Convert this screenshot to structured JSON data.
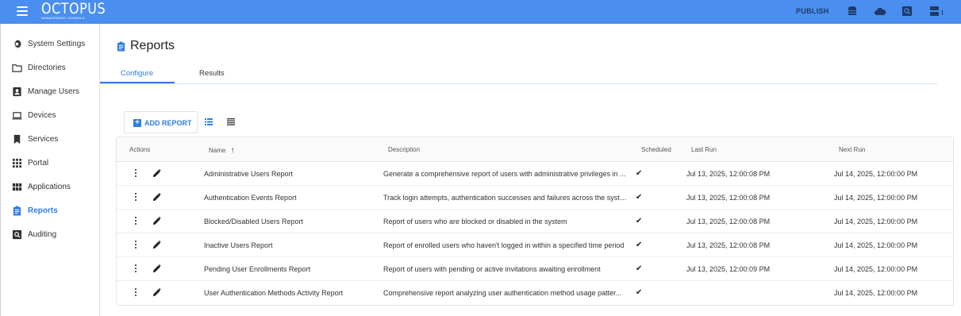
{
  "app": {
    "logo_main": "OCTOPUS",
    "logo_sub": "MANAGEMENT CONSOLE",
    "publish_label": "PUBLISH",
    "accent": "#2f7de1",
    "topbar_color": "#4a8ef0",
    "topbar_icons": [
      "database-icon",
      "cloud-icon",
      "search-box-icon",
      "server-settings-icon"
    ]
  },
  "sidebar": {
    "items": [
      {
        "label": "System Settings",
        "icon": "gear-icon"
      },
      {
        "label": "Directories",
        "icon": "folder-icon"
      },
      {
        "label": "Manage Users",
        "icon": "user-badge-icon"
      },
      {
        "label": "Devices",
        "icon": "laptop-icon"
      },
      {
        "label": "Services",
        "icon": "bookmark-icon"
      },
      {
        "label": "Portal",
        "icon": "grid-dots-icon"
      },
      {
        "label": "Applications",
        "icon": "apps-icon"
      },
      {
        "label": "Reports",
        "icon": "clipboard-icon",
        "active": true
      },
      {
        "label": "Auditing",
        "icon": "search-box-icon"
      }
    ]
  },
  "page": {
    "title": "Reports"
  },
  "tabs": [
    {
      "label": "Configure",
      "active": true
    },
    {
      "label": "Results",
      "active": false
    }
  ],
  "toolbar": {
    "add_report_label": "ADD REPORT"
  },
  "table": {
    "headers": {
      "actions": "Actions",
      "name": "Name",
      "description": "Description",
      "scheduled": "Scheduled",
      "last_run": "Last Run",
      "next_run": "Next Run"
    },
    "sort": {
      "column": "name",
      "direction": "ascending"
    },
    "rows": [
      {
        "name": "Administrative Users Report",
        "description": "Generate a comprehensive report of users with administrative privileges in ...",
        "scheduled": "✔",
        "last_run": "Jul 13, 2025, 12:00:08 PM",
        "next_run": "Jul 14, 2025, 12:00:00 PM"
      },
      {
        "name": "Authentication Events Report",
        "description": "Track login attempts, authentication successes and failures across the syste...",
        "scheduled": "✔",
        "last_run": "Jul 13, 2025, 12:00:08 PM",
        "next_run": "Jul 14, 2025, 12:00:00 PM"
      },
      {
        "name": "Blocked/Disabled Users Report",
        "description": "Report of users who are blocked or disabled in the system",
        "scheduled": "✔",
        "last_run": "Jul 13, 2025, 12:00:08 PM",
        "next_run": "Jul 14, 2025, 12:00:00 PM"
      },
      {
        "name": "Inactive Users Report",
        "description": "Report of enrolled users who haven't logged in within a specified time period",
        "scheduled": "✔",
        "last_run": "Jul 13, 2025, 12:00:08 PM",
        "next_run": "Jul 14, 2025, 12:00:00 PM"
      },
      {
        "name": "Pending User Enrollments Report",
        "description": "Report of users with pending or active invitations awaiting enrollment",
        "scheduled": "✔",
        "last_run": "Jul 13, 2025, 12:00:09 PM",
        "next_run": "Jul 14, 2025, 12:00:00 PM"
      },
      {
        "name": "User Authentication Methods Activity Report",
        "description": "Comprehensive report analyzing user authentication method usage patter...",
        "scheduled": "✔",
        "last_run": "",
        "next_run": "Jul 14, 2025, 12:00:00 PM"
      }
    ]
  }
}
